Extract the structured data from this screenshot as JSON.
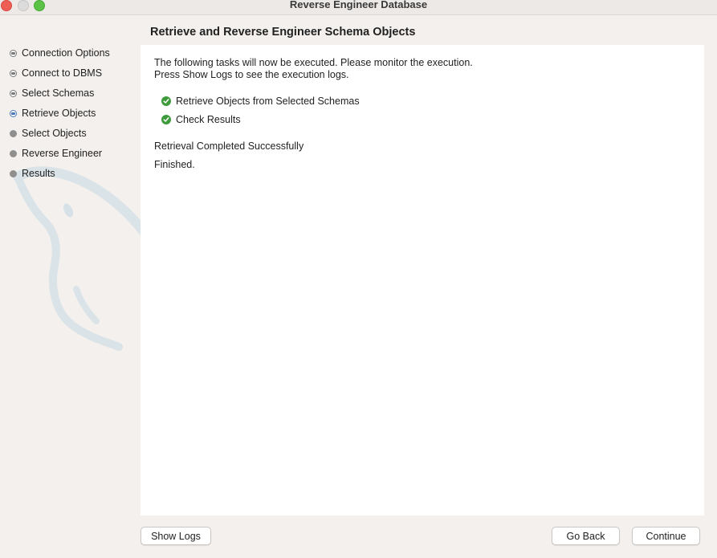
{
  "window": {
    "title": "Reverse Engineer Database"
  },
  "sidebar": {
    "steps": [
      {
        "label": "Connection Options",
        "state": "done"
      },
      {
        "label": "Connect to DBMS",
        "state": "done"
      },
      {
        "label": "Select Schemas",
        "state": "done"
      },
      {
        "label": "Retrieve Objects",
        "state": "current"
      },
      {
        "label": "Select Objects",
        "state": "pending"
      },
      {
        "label": "Reverse Engineer",
        "state": "pending"
      },
      {
        "label": "Results",
        "state": "pending"
      }
    ]
  },
  "main": {
    "title": "Retrieve and Reverse Engineer Schema Objects",
    "intro_line1": "The following tasks will now be executed. Please monitor the execution.",
    "intro_line2": "Press Show Logs to see the execution logs.",
    "tasks": [
      {
        "label": "Retrieve Objects from Selected Schemas",
        "status": "success"
      },
      {
        "label": "Check Results",
        "status": "success"
      }
    ],
    "result_message": "Retrieval Completed Successfully",
    "result_detail": "Finished."
  },
  "footer": {
    "show_logs_label": "Show Logs",
    "go_back_label": "Go Back",
    "continue_label": "Continue"
  },
  "colors": {
    "success": "#3e9b3c",
    "current_step": "#4a78b8",
    "close": "#ee5e55",
    "maximize": "#5bc246"
  }
}
